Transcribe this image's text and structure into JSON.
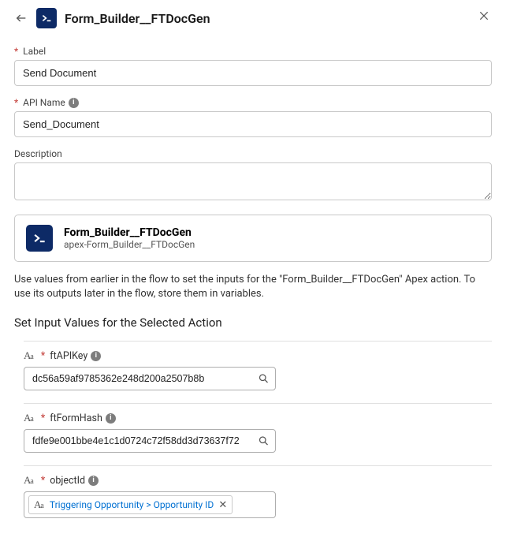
{
  "header": {
    "title": "Form_Builder__FTDocGen"
  },
  "fields": {
    "label": {
      "label": "Label",
      "value": "Send Document"
    },
    "apiName": {
      "label": "API Name",
      "value": "Send_Document"
    },
    "description": {
      "label": "Description",
      "value": ""
    }
  },
  "actionCard": {
    "name": "Form_Builder__FTDocGen",
    "sub": "apex-Form_Builder__FTDocGen"
  },
  "helpText": "Use values from earlier in the flow to set the inputs for the \"Form_Builder__FTDocGen\" Apex action. To use its outputs later in the flow, store them in variables.",
  "sectionTitle": "Set Input Values for the Selected Action",
  "params": {
    "ftAPIKey": {
      "label": "ftAPIKey",
      "value": "dc56a59af9785362e248d200a2507b8b"
    },
    "ftFormHash": {
      "label": "ftFormHash",
      "value": "fdfe9e001bbe4e1c1d0724c72f58dd3d73637f72"
    },
    "objectId": {
      "label": "objectId",
      "pillText": "Triggering Opportunity > Opportunity ID"
    }
  }
}
